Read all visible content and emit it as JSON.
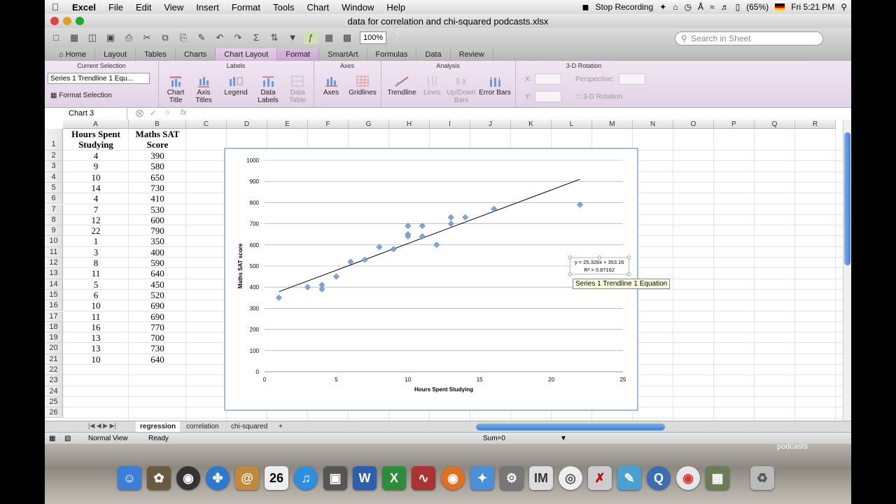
{
  "menubar": {
    "app": "Excel",
    "items": [
      "File",
      "Edit",
      "View",
      "Insert",
      "Format",
      "Tools",
      "Chart",
      "Window",
      "Help"
    ],
    "status_recording": "Stop Recording",
    "battery": "(65%)",
    "clock": "Fri 5:21 PM"
  },
  "window": {
    "title": "data for correlation and chi-squared podcasts.xlsx"
  },
  "toolbar": {
    "zoom": "100%",
    "search_placeholder": "Search in Sheet"
  },
  "ribbon_tabs": [
    "Home",
    "Layout",
    "Tables",
    "Charts",
    "Chart Layout",
    "Format",
    "SmartArt",
    "Formulas",
    "Data",
    "Review"
  ],
  "ribbon": {
    "current_selection": {
      "title": "Current Selection",
      "value": "Series 1 Trendline 1 Equ...",
      "format_btn": "Format Selection"
    },
    "labels": {
      "title": "Labels",
      "buttons": [
        "Chart Title",
        "Axis Titles",
        "Legend",
        "Data Labels",
        "Data Table"
      ]
    },
    "axes": {
      "title": "Axes",
      "buttons": [
        "Axes",
        "Gridlines"
      ]
    },
    "analysis": {
      "title": "Analysis",
      "buttons": [
        "Trendline",
        "Lines",
        "Up/Down Bars",
        "Error Bars"
      ]
    },
    "rotation": {
      "title": "3-D Rotation",
      "x": "X:",
      "y": "Y:",
      "perspective": "Perspective:",
      "btn": "3-D Rotation"
    }
  },
  "formula_bar": {
    "name_box": "Chart 3",
    "fx": "fx"
  },
  "columns": [
    "A",
    "B",
    "C",
    "D",
    "E",
    "F",
    "G",
    "H",
    "I",
    "J",
    "K",
    "L",
    "M",
    "N",
    "O",
    "P",
    "Q",
    "R"
  ],
  "rows": [
    "1",
    "2",
    "3",
    "4",
    "5",
    "6",
    "7",
    "8",
    "9",
    "10",
    "11",
    "12",
    "13",
    "14",
    "15",
    "16",
    "17",
    "18",
    "19",
    "20",
    "21",
    "22",
    "23",
    "24",
    "25",
    "26"
  ],
  "table": {
    "header_a": [
      "Hours Spent",
      "Studying"
    ],
    "header_b": [
      "Maths SAT",
      "Score"
    ],
    "hours": [
      "4",
      "9",
      "10",
      "14",
      "4",
      "7",
      "12",
      "22",
      "1",
      "3",
      "8",
      "11",
      "5",
      "6",
      "10",
      "11",
      "16",
      "13",
      "13",
      "10"
    ],
    "scores": [
      "390",
      "580",
      "650",
      "730",
      "410",
      "530",
      "600",
      "790",
      "350",
      "400",
      "590",
      "640",
      "450",
      "520",
      "690",
      "690",
      "770",
      "700",
      "730",
      "640"
    ]
  },
  "chart_data": {
    "type": "scatter",
    "x": [
      4,
      9,
      10,
      14,
      4,
      7,
      12,
      22,
      1,
      3,
      8,
      11,
      5,
      6,
      10,
      11,
      16,
      13,
      13,
      10
    ],
    "y": [
      390,
      580,
      650,
      730,
      410,
      530,
      600,
      790,
      350,
      400,
      590,
      640,
      450,
      520,
      690,
      690,
      770,
      700,
      730,
      640
    ],
    "xlabel": "Hours Spent Studying",
    "ylabel": "Maths SAT score",
    "xlim": [
      0,
      25
    ],
    "ylim": [
      0,
      1000
    ],
    "xticks": [
      "0",
      "5",
      "10",
      "15",
      "20",
      "25"
    ],
    "yticks": [
      "0",
      "100",
      "200",
      "300",
      "400",
      "500",
      "600",
      "700",
      "800",
      "900",
      "1000"
    ],
    "trendline": {
      "slope": 25.326,
      "intercept": 353.16,
      "x_range": [
        1,
        22
      ]
    },
    "trendline_equation": "y = 25.326x + 353.16",
    "r_squared": "R² = 0.87162",
    "grid": true,
    "colors": {
      "point": "#7ea6d8",
      "line": "#000000",
      "grid": "#9a9a9a"
    }
  },
  "tooltip": "Series 1 Trendline 1 Equation",
  "sheets": {
    "tabs": [
      "regression",
      "correlation",
      "chi-squared"
    ],
    "active": "regression",
    "add": "+"
  },
  "statusbar": {
    "view": "Normal View",
    "state": "Ready",
    "sum": "Sum=0"
  },
  "desktop": {
    "label": "podcasts",
    "calendar_day": "26",
    "im_label": "IM"
  }
}
